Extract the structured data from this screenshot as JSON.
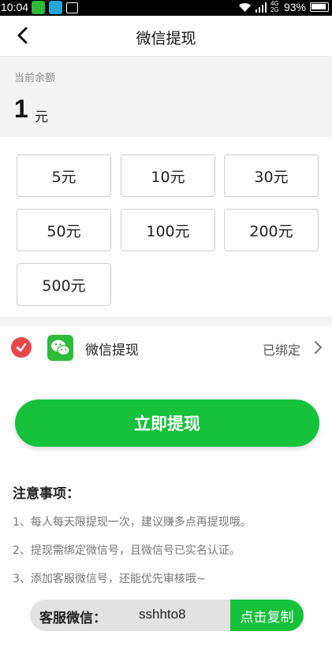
{
  "status_bar": {
    "time": "10:04",
    "battery": "93%",
    "network": "4G 2G",
    "icons": [
      "wechat-icon",
      "box-icon",
      "bag-icon",
      "wifi-icon",
      "signal-icon",
      "battery-icon"
    ]
  },
  "navbar": {
    "title": "微信提现",
    "back_icon": "chevron-left-icon"
  },
  "balance": {
    "label": "当前余额",
    "amount": "1",
    "unit": "元"
  },
  "amount_options": [
    {
      "label": "5元"
    },
    {
      "label": "10元"
    },
    {
      "label": "30元"
    },
    {
      "label": "50元"
    },
    {
      "label": "100元"
    },
    {
      "label": "200元"
    },
    {
      "label": "500元"
    }
  ],
  "payment_method": {
    "label": "微信提现",
    "status": "已绑定",
    "selected": true,
    "icon": "wechat-icon"
  },
  "submit_button": {
    "label": "立即提现"
  },
  "notes": {
    "title": "注意事项：",
    "items": [
      "1、每人每天限提现一次，建议赚多点再提现哦。",
      "2、提现需绑定微信号，且微信号已实名认证。",
      "3、添加客服微信号，还能优先审核哦~"
    ]
  },
  "customer_service": {
    "label": "客服微信：",
    "wechat_id": "sshhto8",
    "copy_label": "点击复制"
  },
  "colors": {
    "primary_green": "#16c13b",
    "wechat_green": "#2dbb3a",
    "check_red": "#e8474a",
    "background_gray": "#f3f3f3"
  }
}
